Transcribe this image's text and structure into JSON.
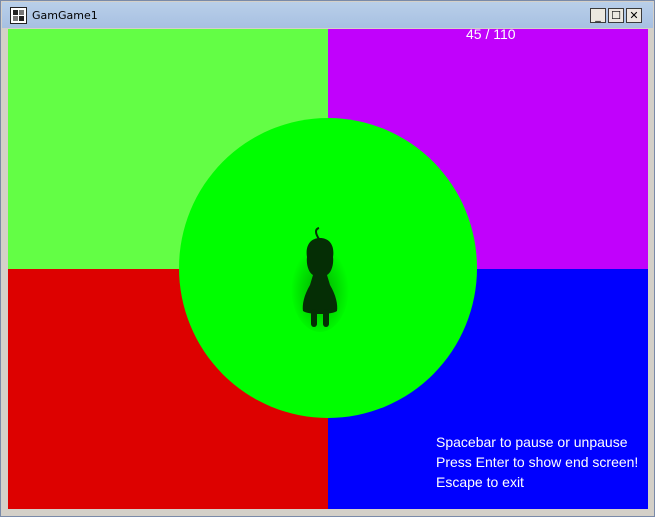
{
  "window": {
    "title": "GamGame1",
    "controls": {
      "minimize": "_",
      "maximize": "☐",
      "close": "✕"
    }
  },
  "game": {
    "counter": "45 / 110",
    "quadrants": {
      "top_left": "#63fe45",
      "top_right": "#c101fc",
      "bottom_left": "#dd0100",
      "bottom_right": "#0000ff"
    },
    "circle_color": "#00fe00",
    "character_icon": "girl-silhouette-icon",
    "hints": [
      "Spacebar to pause or unpause",
      "Press Enter to show end screen!",
      "Escape to exit"
    ]
  }
}
